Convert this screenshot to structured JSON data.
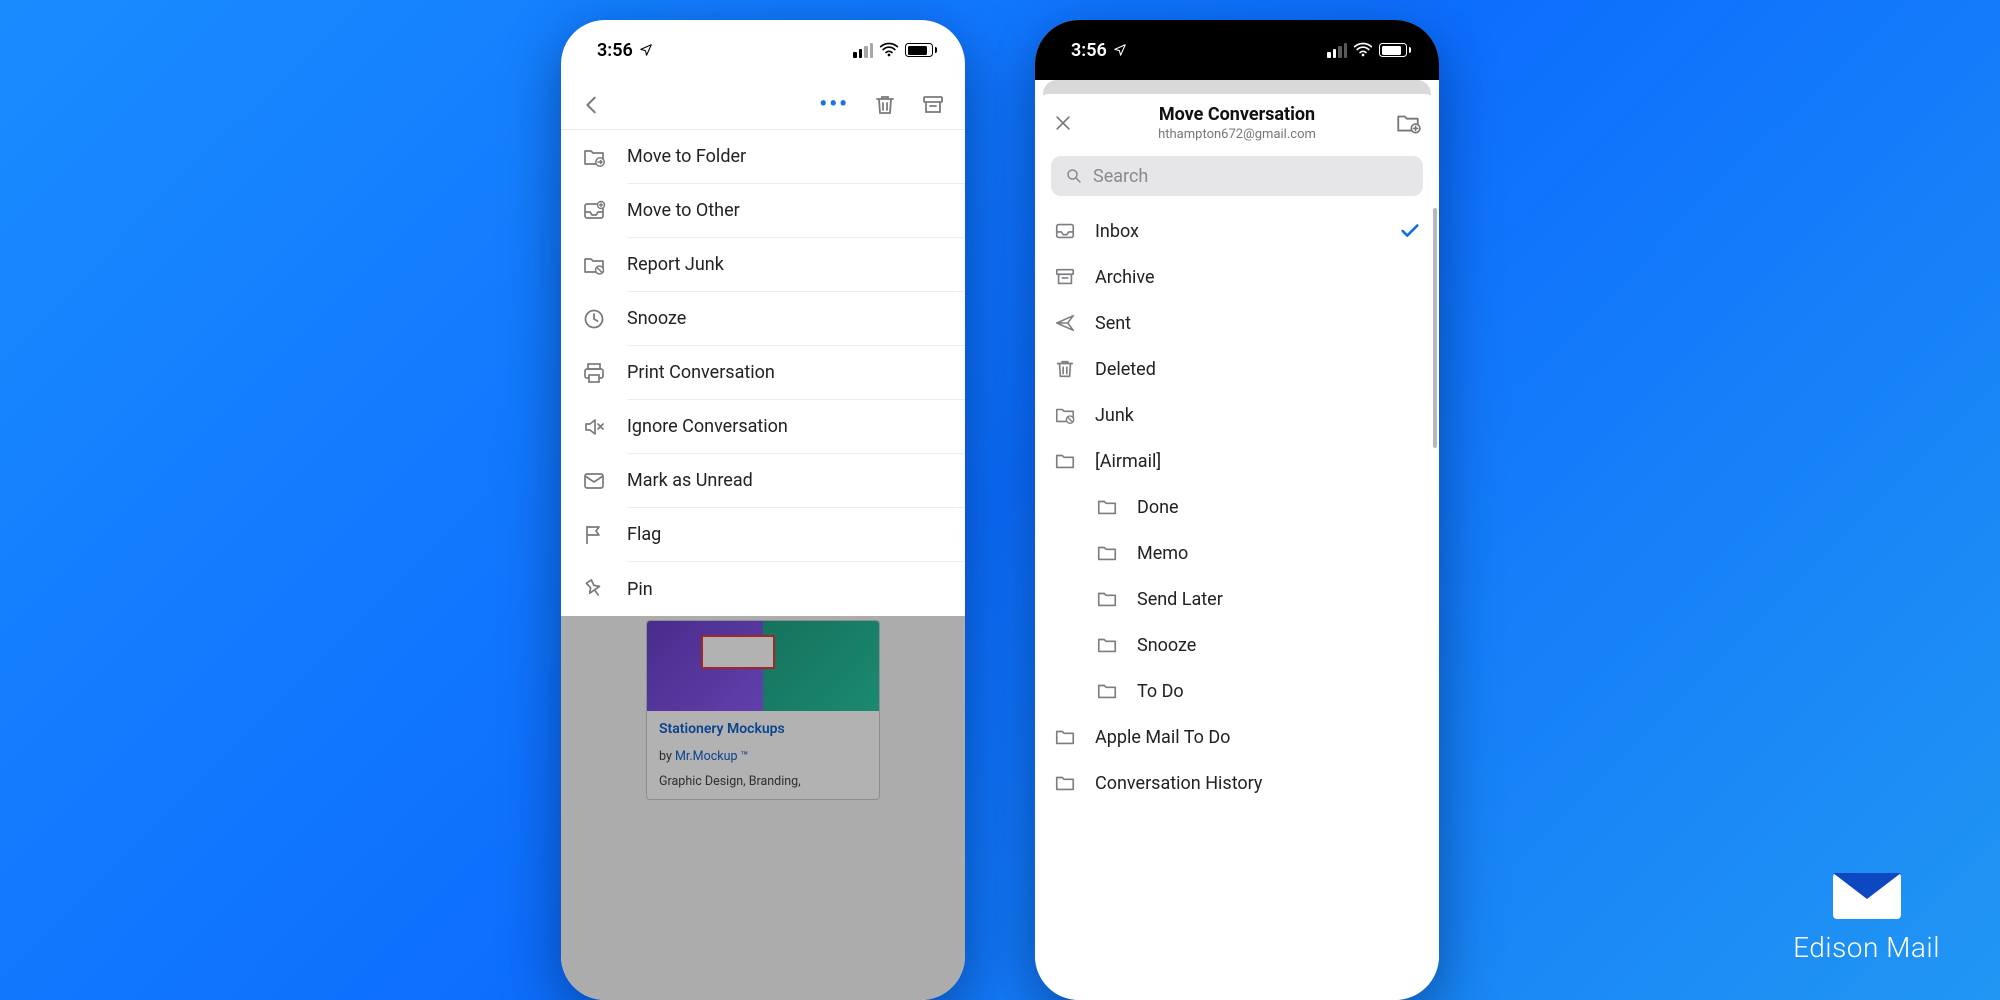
{
  "status": {
    "time": "3:56"
  },
  "left": {
    "actions": [
      {
        "label": "Move to Folder",
        "icon": "folder-move-icon"
      },
      {
        "label": "Move to Other",
        "icon": "inbox-move-icon"
      },
      {
        "label": "Report Junk",
        "icon": "junk-icon"
      },
      {
        "label": "Snooze",
        "icon": "clock-icon"
      },
      {
        "label": "Print Conversation",
        "icon": "print-icon"
      },
      {
        "label": "Ignore Conversation",
        "icon": "mute-icon"
      },
      {
        "label": "Mark as Unread",
        "icon": "envelope-icon"
      },
      {
        "label": "Flag",
        "icon": "flag-icon"
      },
      {
        "label": "Pin",
        "icon": "pin-icon"
      }
    ],
    "preview": {
      "title": "Stationery Mockups",
      "by_prefix": "by ",
      "by_link": "Mr.Mockup ™",
      "tags": "Graphic Design, Branding,"
    }
  },
  "right": {
    "title": "Move Conversation",
    "subtitle": "hthampton672@gmail.com",
    "search_placeholder": "Search",
    "folders": [
      {
        "label": "Inbox",
        "icon": "inbox-icon",
        "selected": true
      },
      {
        "label": "Archive",
        "icon": "archive-icon"
      },
      {
        "label": "Sent",
        "icon": "send-icon"
      },
      {
        "label": "Deleted",
        "icon": "trash-icon"
      },
      {
        "label": "Junk",
        "icon": "junk-icon"
      },
      {
        "label": "[Airmail]",
        "icon": "folder-icon"
      },
      {
        "label": "Done",
        "icon": "folder-icon",
        "sub": true
      },
      {
        "label": "Memo",
        "icon": "folder-icon",
        "sub": true
      },
      {
        "label": "Send Later",
        "icon": "folder-icon",
        "sub": true
      },
      {
        "label": "Snooze",
        "icon": "folder-icon",
        "sub": true
      },
      {
        "label": "To Do",
        "icon": "folder-icon",
        "sub": true
      },
      {
        "label": "Apple Mail To Do",
        "icon": "folder-icon"
      },
      {
        "label": "Conversation History",
        "icon": "folder-icon"
      }
    ]
  },
  "brand": {
    "text": "Edison Mail"
  }
}
